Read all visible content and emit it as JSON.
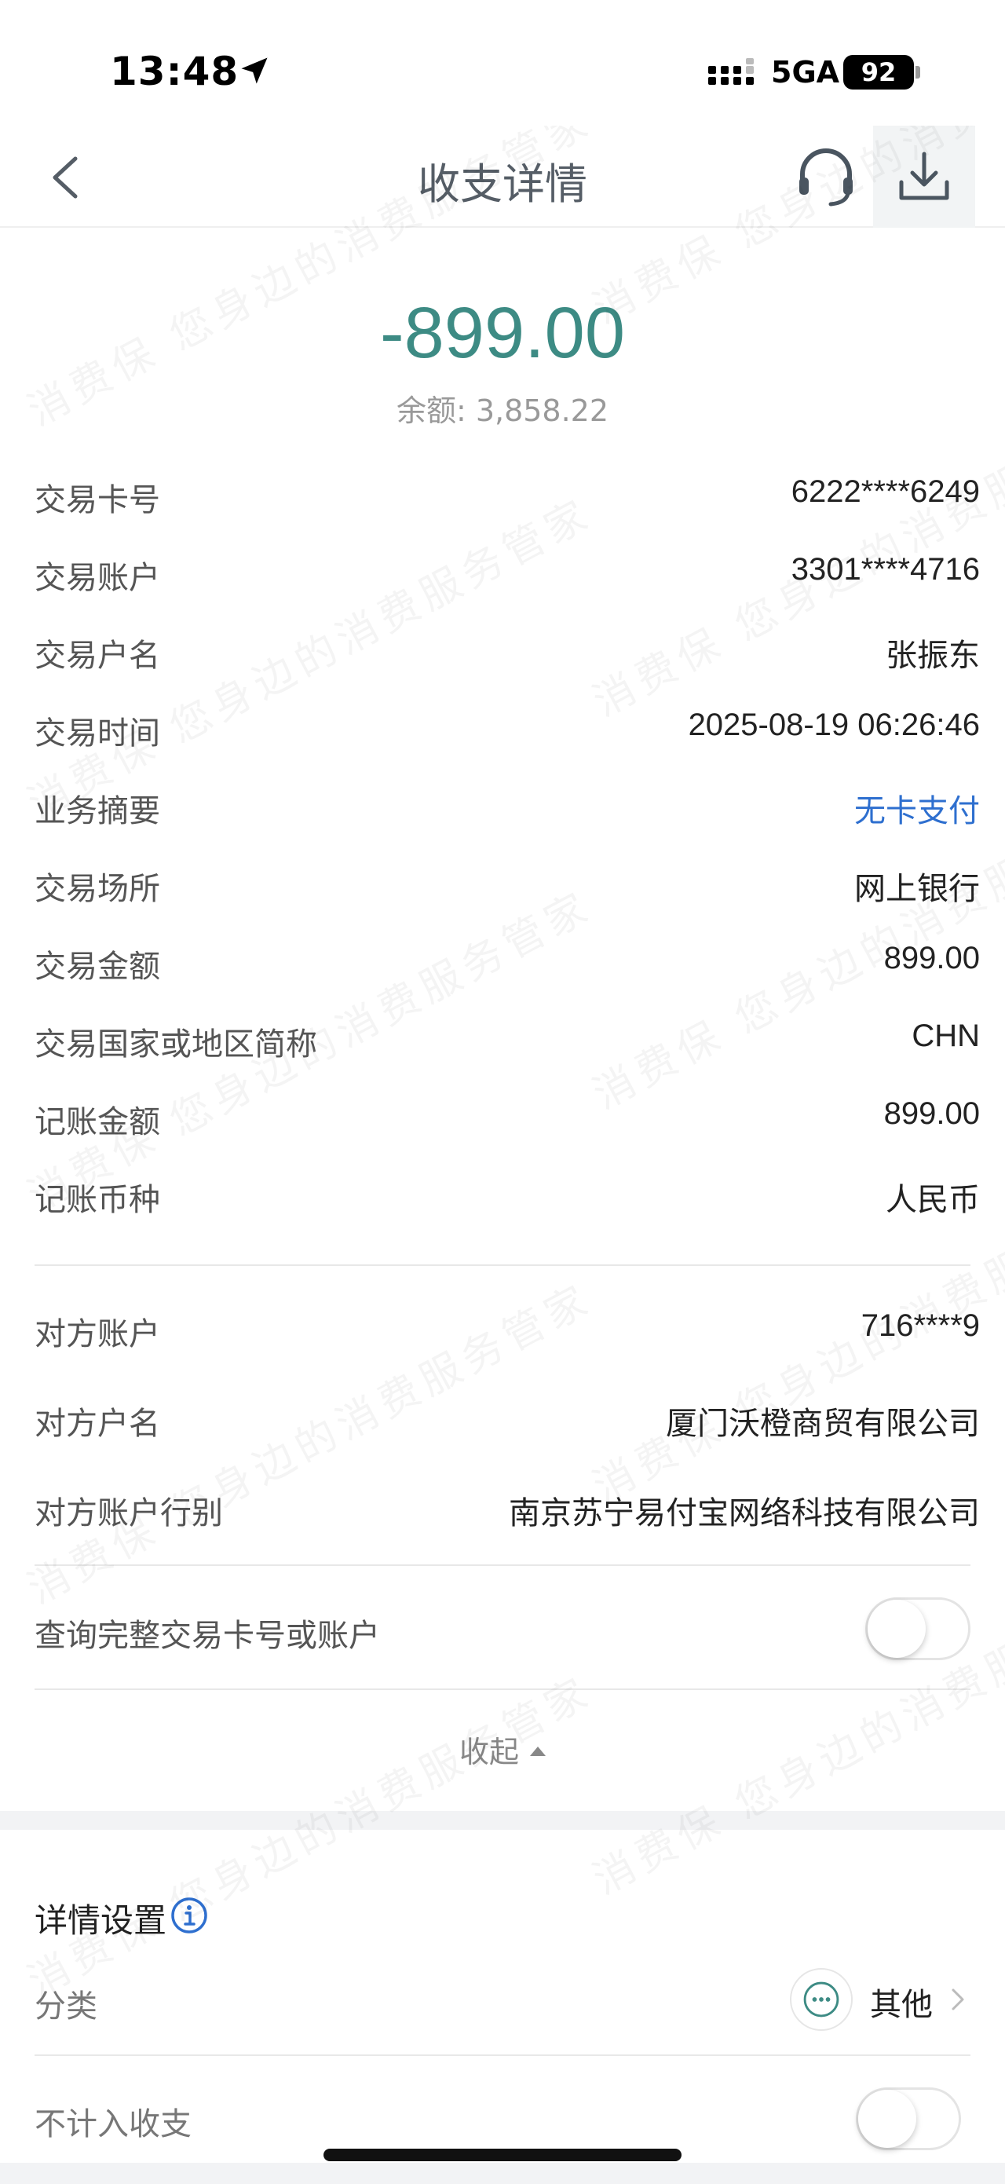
{
  "status_bar": {
    "time": "13:48",
    "network": "5GA",
    "battery": "92"
  },
  "nav": {
    "title": "收支详情"
  },
  "header": {
    "amount": "-899.00",
    "balance": "余额: 3,858.22",
    "amount_color": "#3d8b84"
  },
  "details": [
    {
      "label": "交易卡号",
      "value": "6222****6249"
    },
    {
      "label": "交易账户",
      "value": "3301****4716"
    },
    {
      "label": "交易户名",
      "value": "张振东"
    },
    {
      "label": "交易时间",
      "value": "2025-08-19 06:26:46"
    },
    {
      "label": "业务摘要",
      "value": "无卡支付"
    },
    {
      "label": "交易场所",
      "value": "网上银行"
    },
    {
      "label": "交易金额",
      "value": "899.00"
    },
    {
      "label": "交易国家或地区简称",
      "value": "CHN"
    },
    {
      "label": "记账金额",
      "value": "899.00"
    },
    {
      "label": "记账币种",
      "value": "人民币"
    }
  ],
  "counterparty": [
    {
      "label": "对方账户",
      "value": "716****9"
    },
    {
      "label": "对方户名",
      "value": "厦门沃橙商贸有限公司"
    },
    {
      "label": "对方账户行别",
      "value": "南京苏宁易付宝网络科技有限公司"
    }
  ],
  "query_full": {
    "label": "查询完整交易卡号或账户",
    "enabled": false
  },
  "collapse_label": "收起",
  "settings": {
    "title": "详情设置",
    "category_label": "分类",
    "category_value": "其他",
    "exclude_label": "不计入收支",
    "exclude_enabled": false
  },
  "watermark_text": "消费保 您身边的消费服务管家",
  "link_color": "#2e6fcf"
}
